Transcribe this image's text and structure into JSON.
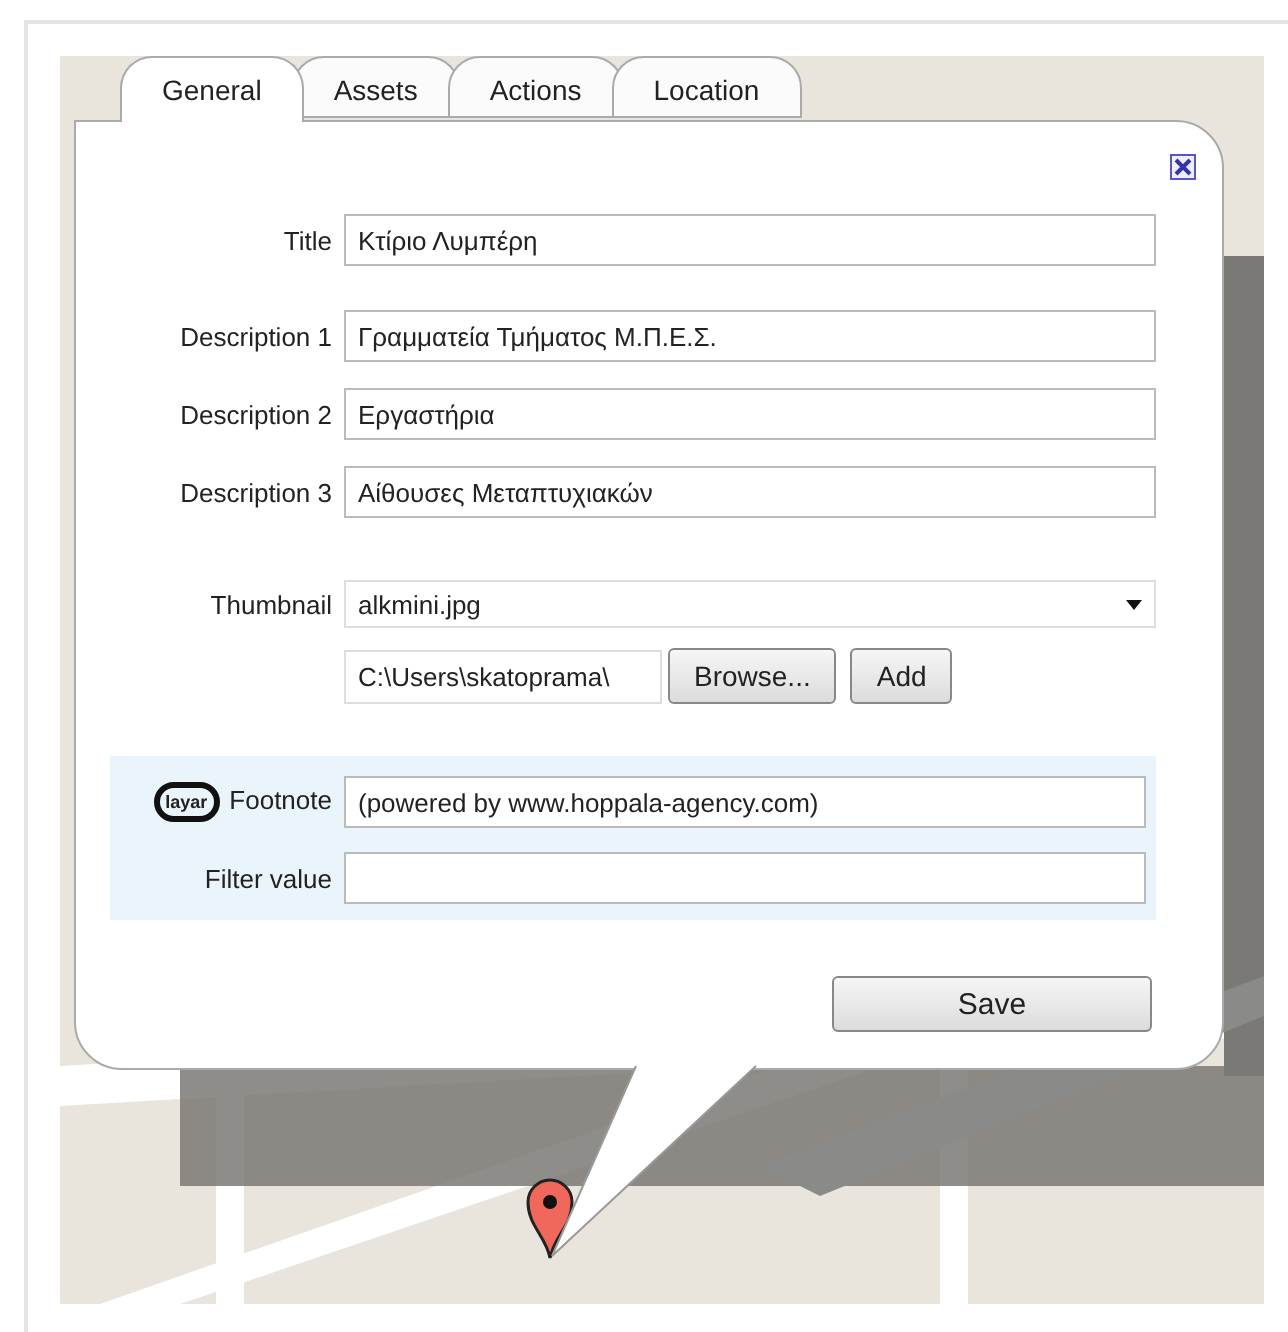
{
  "tabs": [
    {
      "label": "General",
      "selected": true
    },
    {
      "label": "Assets",
      "selected": false
    },
    {
      "label": "Actions",
      "selected": false
    },
    {
      "label": "Location",
      "selected": false
    }
  ],
  "fields": [
    {
      "label": "Title",
      "value": "Κτίριο Λυμπέρη"
    },
    {
      "label": "Description 1",
      "value": "Γραμματεία Τμήματος Μ.Π.Ε.Σ."
    },
    {
      "label": "Description 2",
      "value": "Εργαστήρια"
    },
    {
      "label": "Description 3",
      "value": "Αίθουσες Μεταπτυχιακών"
    }
  ],
  "thumbnail": {
    "label": "Thumbnail",
    "value": "alkmini.jpg",
    "file": "C:\\Users\\skatoprama\\",
    "buttons": [
      "Browse...",
      "Add"
    ]
  },
  "footnote": {
    "logo": "layar",
    "label": "Footnote",
    "value": "(powered by www.hoppala-agency.com)"
  },
  "filter": {
    "label": "Filter value"
  },
  "save": "Save"
}
